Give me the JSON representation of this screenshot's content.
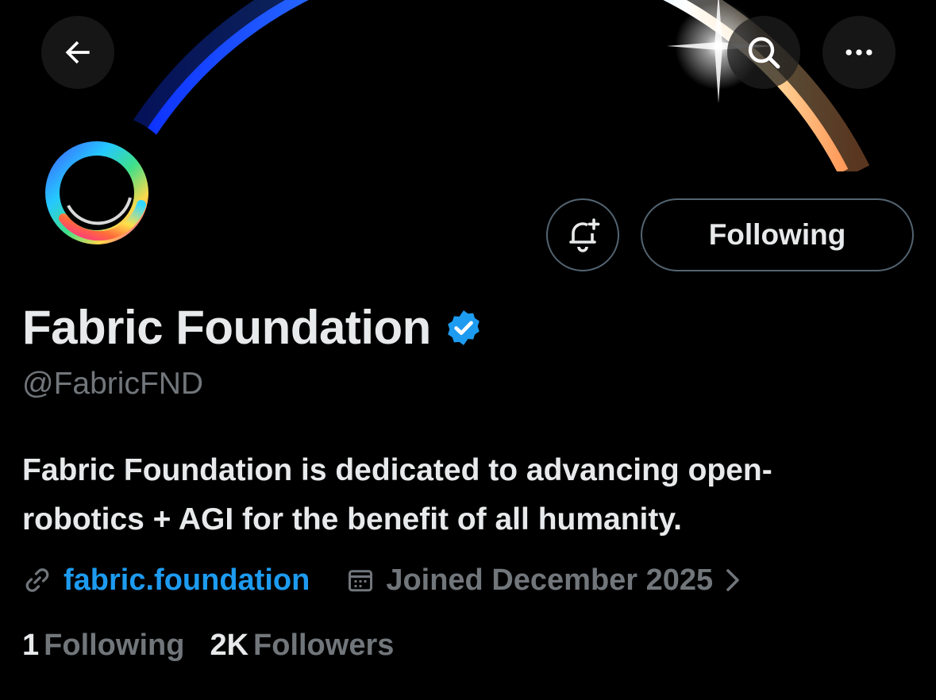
{
  "header": {
    "back_icon": "arrow-left-icon",
    "search_icon": "search-icon",
    "more_icon": "more-horizontal-icon"
  },
  "profile": {
    "display_name": "Fabric Foundation",
    "verified_icon": "verified-badge-icon",
    "verified_color": "#1d9bf0",
    "handle": "@FabricFND",
    "bio_line1": "Fabric Foundation is dedicated to advancing open-",
    "bio_line2": "robotics + AGI for the benefit of all humanity.",
    "website": "fabric.foundation",
    "joined": "Joined December 2025",
    "following_count": "1",
    "following_label": "Following",
    "followers_count": "2K",
    "followers_label": "Followers"
  },
  "actions": {
    "notify_icon": "bell-plus-icon",
    "following_button": "Following"
  },
  "colors": {
    "background": "#000000",
    "text_primary": "#e7e9ea",
    "text_secondary": "#71767b",
    "link": "#1d9bf0"
  }
}
